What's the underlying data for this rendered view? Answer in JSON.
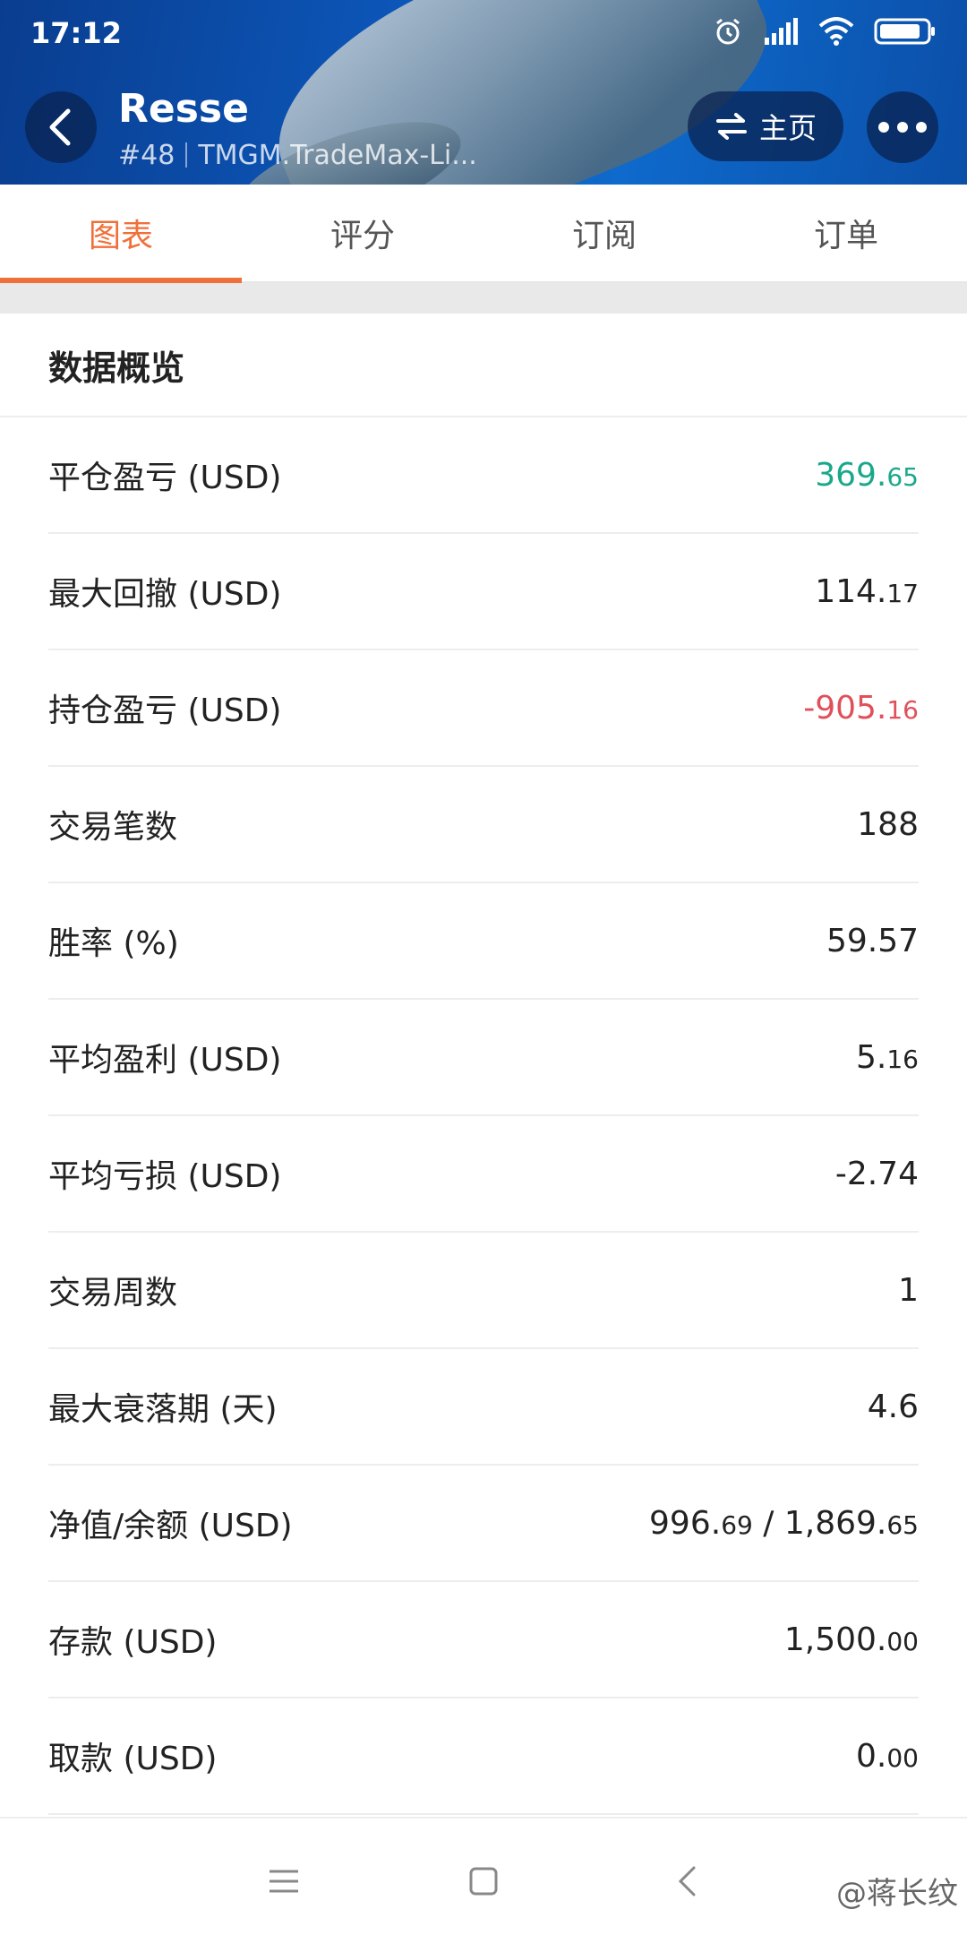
{
  "status_bar": {
    "time": "17:12",
    "icons": [
      "alarm-icon",
      "signal-icon",
      "wifi-icon",
      "battery-icon"
    ]
  },
  "header": {
    "name": "Resse",
    "rank": "#48",
    "server": "TMGM.TradeMax-Li...",
    "home_label": "主页"
  },
  "tabs": [
    {
      "label": "图表",
      "active": true
    },
    {
      "label": "评分",
      "active": false
    },
    {
      "label": "订阅",
      "active": false
    },
    {
      "label": "订单",
      "active": false
    }
  ],
  "section": {
    "title": "数据概览",
    "rows": [
      {
        "label": "平仓盈亏 (USD)",
        "value_main": "369.",
        "value_small": "65",
        "status": "positive"
      },
      {
        "label": "最大回撤 (USD)",
        "value_main": "114.",
        "value_small": "17",
        "status": "neutral"
      },
      {
        "label": "持仓盈亏 (USD)",
        "value_main": "-905.",
        "value_small": "16",
        "status": "negative"
      },
      {
        "label": "交易笔数",
        "value_main": "188",
        "value_small": "",
        "status": "neutral"
      },
      {
        "label": "胜率 (%)",
        "value_main": "59.57",
        "value_small": "",
        "status": "neutral"
      },
      {
        "label": "平均盈利 (USD)",
        "value_main": "5.",
        "value_small": "16",
        "status": "neutral"
      },
      {
        "label": "平均亏损 (USD)",
        "value_main": "-2.74",
        "value_small": "",
        "status": "neutral"
      },
      {
        "label": "交易周数",
        "value_main": "1",
        "value_small": "",
        "status": "neutral"
      },
      {
        "label": "最大衰落期 (天)",
        "value_main": "4.6",
        "value_small": "",
        "status": "neutral"
      },
      {
        "label": "净值/余额 (USD)",
        "value_main": "996.",
        "value_small": "69",
        "value_main2": " / 1,869.",
        "value_small2": "65",
        "status": "neutral"
      },
      {
        "label": "存款 (USD)",
        "value_main": "1,500.",
        "value_small": "00",
        "status": "neutral"
      },
      {
        "label": "取款 (USD)",
        "value_main": "0.",
        "value_small": "00",
        "status": "neutral"
      }
    ]
  },
  "watermark": "@蒋长纹",
  "colors": {
    "accent": "#f0703a",
    "positive": "#1aa88a",
    "negative": "#e0505a",
    "header_bg": "#0c56b8"
  }
}
